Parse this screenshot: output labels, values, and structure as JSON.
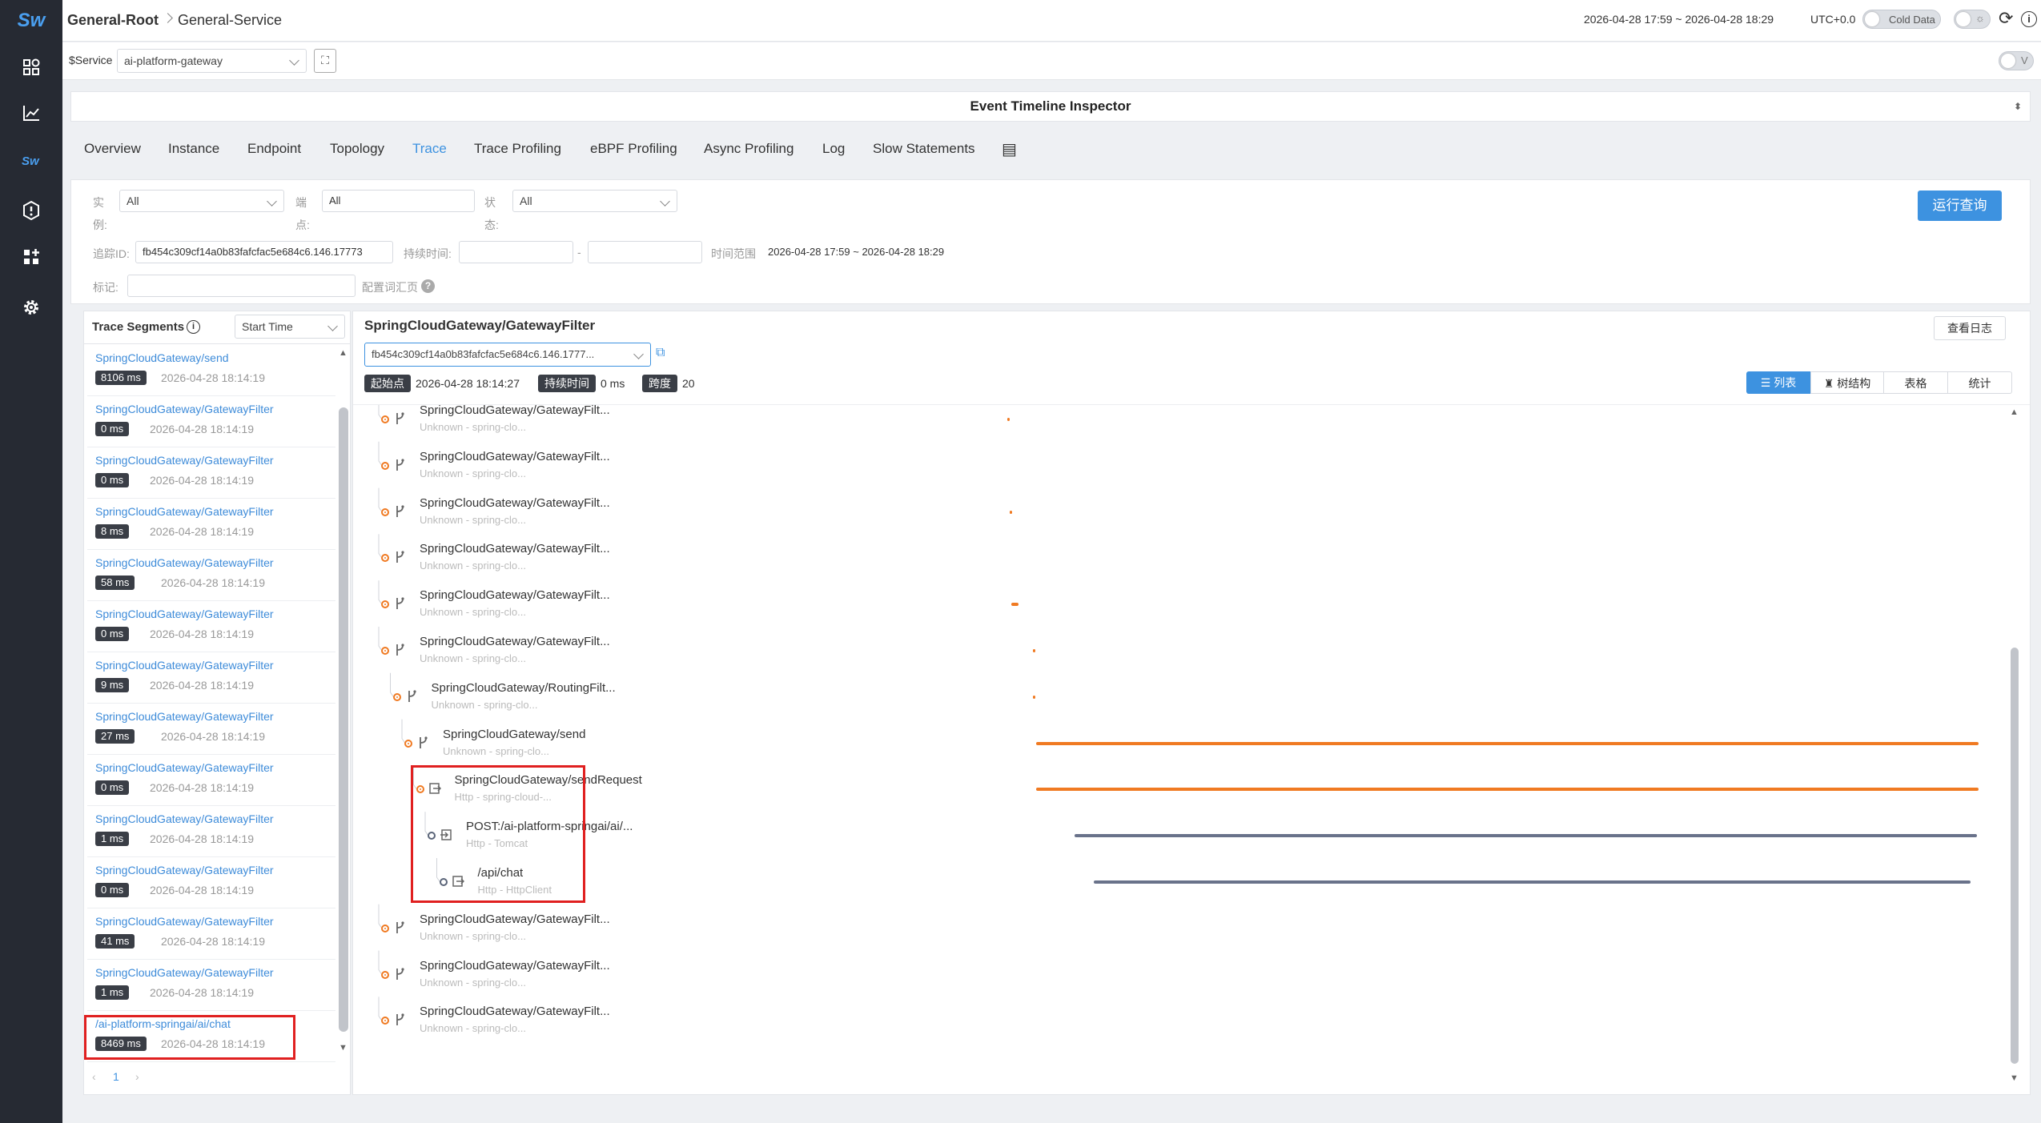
{
  "sidebar": {
    "logo": "Sw",
    "icons": [
      "dashboard-icon",
      "chart-icon",
      "sw-logo-icon",
      "alarm-icon",
      "widget-add-icon",
      "gear-icon"
    ]
  },
  "header": {
    "breadcrumb": [
      "General-Root",
      "General-Service"
    ],
    "time_range": "2026-04-28 17:59 ~ 2026-04-28 18:29",
    "timezone": "UTC+0.0",
    "cold_data_label": "Cold Data"
  },
  "service_bar": {
    "label": "$Service",
    "value": "ai-platform-gateway",
    "toggle_label": "V"
  },
  "panel_title": "Event Timeline Inspector",
  "tabs": [
    "Overview",
    "Instance",
    "Endpoint",
    "Topology",
    "Trace",
    "Trace Profiling",
    "eBPF Profiling",
    "Async Profiling",
    "Log",
    "Slow Statements"
  ],
  "active_tab": "Trace",
  "filters": {
    "instance_label_1": "实",
    "instance_label_2": "例:",
    "instance_value": "All",
    "endpoint_label_1": "端",
    "endpoint_label_2": "点:",
    "endpoint_value": "All",
    "status_label_1": "状",
    "status_label_2": "态:",
    "status_value": "All",
    "trace_id_label": "追踪ID:",
    "trace_id_value": "fb454c309cf14a0b83fafcfac5e684c6.146.17773",
    "duration_label": "持续时间:",
    "duration_sep": "-",
    "time_range_label": "时间范围",
    "time_range_value": "2026-04-28 17:59 ~ 2026-04-28 18:29",
    "tag_label": "标记:",
    "tag_config_label": "配置词汇页",
    "run_button": "运行查询"
  },
  "segments_panel": {
    "title": "Trace Segments",
    "sort_value": "Start Time",
    "items": [
      {
        "name": "SpringCloudGateway/send",
        "duration": "8106 ms",
        "time": "2026-04-28 18:14:19"
      },
      {
        "name": "SpringCloudGateway/GatewayFilter",
        "duration": "0 ms",
        "time": "2026-04-28 18:14:19"
      },
      {
        "name": "SpringCloudGateway/GatewayFilter",
        "duration": "0 ms",
        "time": "2026-04-28 18:14:19"
      },
      {
        "name": "SpringCloudGateway/GatewayFilter",
        "duration": "8 ms",
        "time": "2026-04-28 18:14:19"
      },
      {
        "name": "SpringCloudGateway/GatewayFilter",
        "duration": "58 ms",
        "time": "2026-04-28 18:14:19"
      },
      {
        "name": "SpringCloudGateway/GatewayFilter",
        "duration": "0 ms",
        "time": "2026-04-28 18:14:19"
      },
      {
        "name": "SpringCloudGateway/GatewayFilter",
        "duration": "9 ms",
        "time": "2026-04-28 18:14:19"
      },
      {
        "name": "SpringCloudGateway/GatewayFilter",
        "duration": "27 ms",
        "time": "2026-04-28 18:14:19"
      },
      {
        "name": "SpringCloudGateway/GatewayFilter",
        "duration": "0 ms",
        "time": "2026-04-28 18:14:19"
      },
      {
        "name": "SpringCloudGateway/GatewayFilter",
        "duration": "1 ms",
        "time": "2026-04-28 18:14:19"
      },
      {
        "name": "SpringCloudGateway/GatewayFilter",
        "duration": "0 ms",
        "time": "2026-04-28 18:14:19"
      },
      {
        "name": "SpringCloudGateway/GatewayFilter",
        "duration": "41 ms",
        "time": "2026-04-28 18:14:19"
      },
      {
        "name": "SpringCloudGateway/GatewayFilter",
        "duration": "1 ms",
        "time": "2026-04-28 18:14:19"
      },
      {
        "name": "/ai-platform-springai/ai/chat",
        "duration": "8469 ms",
        "time": "2026-04-28 18:14:19"
      }
    ],
    "page": "1"
  },
  "detail": {
    "title": "SpringCloudGateway/GatewayFilter",
    "view_log_button": "查看日志",
    "trace_id": "fb454c309cf14a0b83fafcfac5e684c6.146.1777...",
    "start_label": "起始点",
    "start_value": "2026-04-28 18:14:27",
    "duration_label": "持续时间",
    "duration_value": "0 ms",
    "span_label": "跨度",
    "span_value": "20",
    "view_tabs": [
      "列表",
      "树结构",
      "表格",
      "统计"
    ],
    "rows": [
      {
        "name": "SpringCloudGateway/GatewayFilt...",
        "sub": "Unknown - spring-clo..."
      },
      {
        "name": "SpringCloudGateway/GatewayFilt...",
        "sub": "Unknown - spring-clo..."
      },
      {
        "name": "SpringCloudGateway/GatewayFilt...",
        "sub": "Unknown - spring-clo..."
      },
      {
        "name": "SpringCloudGateway/GatewayFilt...",
        "sub": "Unknown - spring-clo..."
      },
      {
        "name": "SpringCloudGateway/GatewayFilt...",
        "sub": "Unknown - spring-clo..."
      },
      {
        "name": "SpringCloudGateway/GatewayFilt...",
        "sub": "Unknown - spring-clo..."
      },
      {
        "name": "SpringCloudGateway/RoutingFilt...",
        "sub": "Unknown - spring-clo..."
      },
      {
        "name": "SpringCloudGateway/send",
        "sub": "Unknown - spring-clo..."
      },
      {
        "name": "SpringCloudGateway/sendRequest",
        "sub": "Http - spring-cloud-..."
      },
      {
        "name": "POST:/ai-platform-springai/ai/...",
        "sub": "Http - Tomcat"
      },
      {
        "name": "/api/chat",
        "sub": "Http - HttpClient"
      },
      {
        "name": "SpringCloudGateway/GatewayFilt...",
        "sub": "Unknown - spring-clo..."
      },
      {
        "name": "SpringCloudGateway/GatewayFilt...",
        "sub": "Unknown - spring-clo..."
      },
      {
        "name": "SpringCloudGateway/GatewayFilt...",
        "sub": "Unknown - spring-clo..."
      }
    ]
  },
  "colors": {
    "accent": "#3d92e0",
    "span_orange": "#f07a22",
    "span_gray": "#69728a",
    "highlight_red": "#e02020",
    "sidebar_bg": "#262a33"
  }
}
